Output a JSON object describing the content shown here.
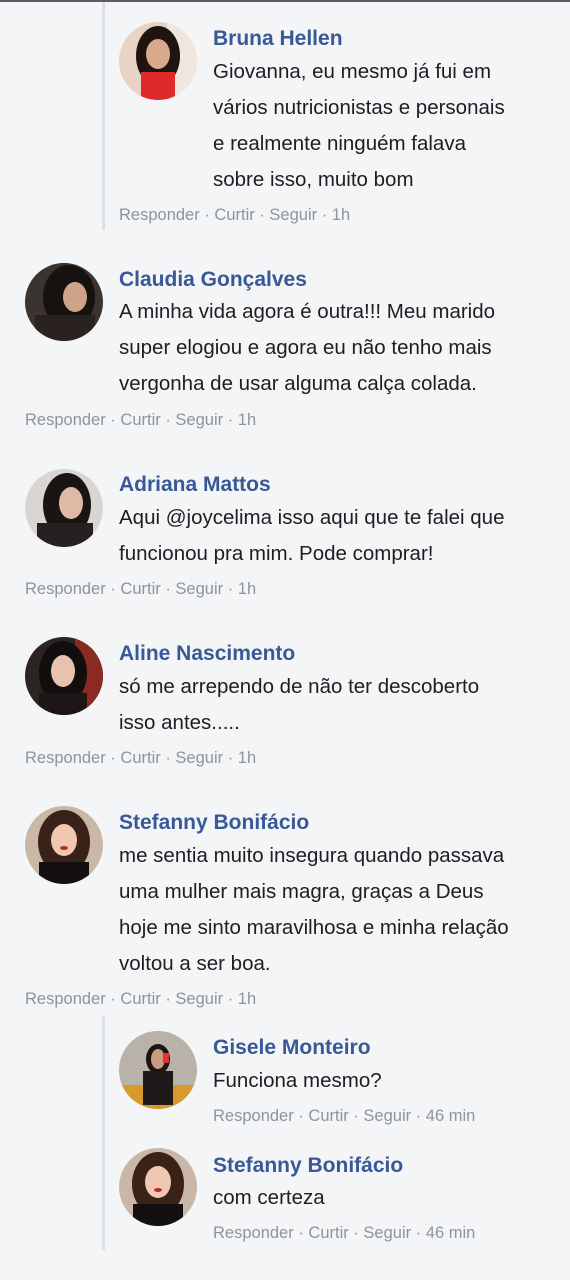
{
  "actions": {
    "reply": "Responder",
    "like": "Curtir",
    "follow": "Seguir",
    "separator": " · "
  },
  "comments": [
    {
      "name": "Bruna Hellen",
      "lines": [
        "Giovanna, eu mesmo já fui em",
        "vários nutricionistas e personais",
        "e realmente ninguém falava",
        "sobre isso, muito bom"
      ],
      "time": "1h"
    },
    {
      "name": "Claudia Gonçalves",
      "lines": [
        "A minha vida agora é outra!!! Meu marido",
        "super elogiou e agora eu não tenho mais",
        "vergonha de usar alguma calça colada."
      ],
      "time": "1h"
    },
    {
      "name": "Adriana Mattos",
      "lines": [
        "Aqui @joycelima isso aqui que te falei que",
        "funcionou pra mim. Pode comprar!"
      ],
      "time": "1h"
    },
    {
      "name": "Aline Nascimento",
      "lines": [
        "só me arrependo de não ter descoberto",
        "isso antes....."
      ],
      "time": "1h"
    },
    {
      "name": "Stefanny Bonifácio",
      "lines": [
        "me sentia muito insegura quando passava",
        "uma mulher mais magra, graças a Deus",
        "hoje me sinto maravilhosa e minha relação",
        "voltou a ser boa."
      ],
      "time": "1h"
    },
    {
      "name": "Gisele Monteiro",
      "lines": [
        "Funciona mesmo?"
      ],
      "time": "46 min"
    },
    {
      "name": "Stefanny Bonifácio",
      "lines": [
        "com certeza"
      ],
      "time": "46 min"
    }
  ],
  "colors": {
    "background": "#f4f5f7",
    "name": "#385898",
    "text": "#1c1e21",
    "meta": "#8d949e",
    "thread_line": "#dcdfe4"
  }
}
